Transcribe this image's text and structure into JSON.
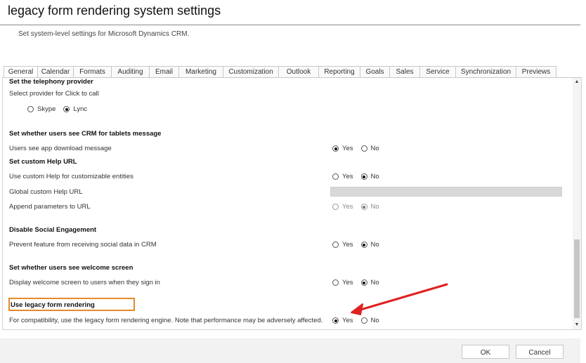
{
  "page": {
    "title": "legacy form rendering system settings",
    "subtitle": "Set system-level settings for Microsoft Dynamics CRM."
  },
  "tabs": [
    {
      "label": "General",
      "active": true
    },
    {
      "label": "Calendar"
    },
    {
      "label": "Formats"
    },
    {
      "label": "Auditing"
    },
    {
      "label": "Email"
    },
    {
      "label": "Marketing"
    },
    {
      "label": "Customization"
    },
    {
      "label": "Outlook"
    },
    {
      "label": "Reporting"
    },
    {
      "label": "Goals"
    },
    {
      "label": "Sales"
    },
    {
      "label": "Service"
    },
    {
      "label": "Synchronization"
    },
    {
      "label": "Previews"
    }
  ],
  "sections": {
    "telephony": {
      "heading": "Set the telephony provider",
      "label": "Select provider for Click to call",
      "options": [
        "Skype",
        "Lync"
      ],
      "selected": "Lync"
    },
    "tablets": {
      "heading": "Set whether users see CRM for tablets message",
      "label": "Users see app download message",
      "options": [
        "Yes",
        "No"
      ],
      "selected": "Yes"
    },
    "help": {
      "heading": "Set custom Help URL",
      "custom_label": "Use custom Help for customizable entities",
      "custom_options": [
        "Yes",
        "No"
      ],
      "custom_selected": "No",
      "url_label": "Global custom Help URL",
      "url_value": "",
      "append_label": "Append parameters to URL",
      "append_options": [
        "Yes",
        "No"
      ],
      "append_selected": "No"
    },
    "social": {
      "heading": "Disable Social Engagement",
      "label": "Prevent feature from receiving social data in CRM",
      "options": [
        "Yes",
        "No"
      ],
      "selected": "No"
    },
    "welcome": {
      "heading": "Set whether users see welcome screen",
      "label": "Display welcome screen to users when they sign in",
      "options": [
        "Yes",
        "No"
      ],
      "selected": "No"
    },
    "legacy": {
      "heading": "Use legacy form rendering",
      "label": "For compatibility, use the legacy form rendering engine. Note that performance may be adversely affected.",
      "options": [
        "Yes",
        "No"
      ],
      "selected": "Yes"
    }
  },
  "footer": {
    "ok_label": "OK",
    "cancel_label": "Cancel"
  },
  "annotation": {
    "highlight_color": "#e8892b",
    "arrow_color": "#e02020"
  }
}
